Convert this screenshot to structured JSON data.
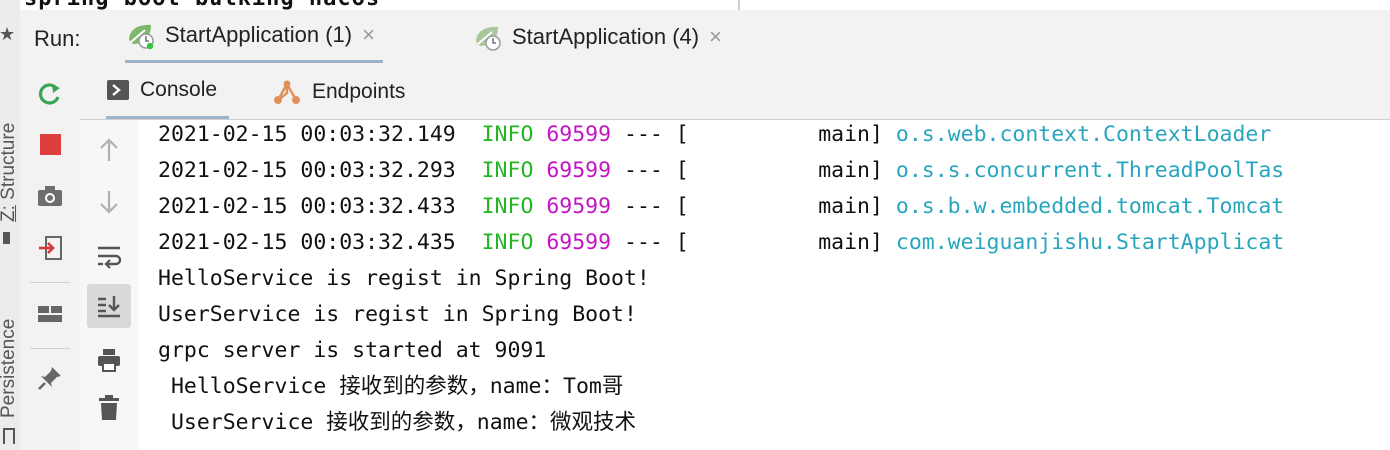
{
  "side_strip": {
    "labels": [
      "Structure",
      "Persistence"
    ],
    "structure_shortcut": "Z:"
  },
  "editor_remnant": {
    "text": "spring-boot-bulking-nacos"
  },
  "run_bar": {
    "label": "Run:",
    "tabs": [
      {
        "label": "StartApplication (1)",
        "active": true,
        "close": "×"
      },
      {
        "label": "StartApplication (4)",
        "active": false,
        "close": "×"
      }
    ]
  },
  "sub_tabs": [
    {
      "label": "Console",
      "active": true
    },
    {
      "label": "Endpoints",
      "active": false
    }
  ],
  "toolbar1": [
    "rerun-icon",
    "stop-icon",
    "camera-icon",
    "exit-icon",
    "layout-icon",
    "pin-icon"
  ],
  "toolbar2": [
    "arrow-up-icon",
    "arrow-down-icon",
    "soft-wrap-icon",
    "scroll-to-end-icon",
    "print-icon",
    "trash-icon"
  ],
  "colors": {
    "level": "#23b623",
    "pid": "#c313c3",
    "logger": "#28a6bd",
    "accent": "#9fb3c8"
  },
  "console": {
    "log_lines": [
      {
        "ts": "2021-02-15 00:03:32.149",
        "level": "INFO",
        "pid": "69599",
        "sep": "--- [",
        "thread": "main]",
        "logger": "o.s.web.context.ContextLoader"
      },
      {
        "ts": "2021-02-15 00:03:32.293",
        "level": "INFO",
        "pid": "69599",
        "sep": "--- [",
        "thread": "main]",
        "logger": "o.s.s.concurrent.ThreadPoolTas"
      },
      {
        "ts": "2021-02-15 00:03:32.433",
        "level": "INFO",
        "pid": "69599",
        "sep": "--- [",
        "thread": "main]",
        "logger": "o.s.b.w.embedded.tomcat.Tomcat"
      },
      {
        "ts": "2021-02-15 00:03:32.435",
        "level": "INFO",
        "pid": "69599",
        "sep": "--- [",
        "thread": "main]",
        "logger": "com.weiguanjishu.StartApplicat"
      }
    ],
    "plain_lines": [
      "HelloService is regist in Spring Boot!",
      "UserService is regist in Spring Boot!",
      "grpc server is started at 9091",
      " HelloService 接收到的参数，name：Tom哥",
      " UserService 接收到的参数，name：微观技术"
    ]
  }
}
